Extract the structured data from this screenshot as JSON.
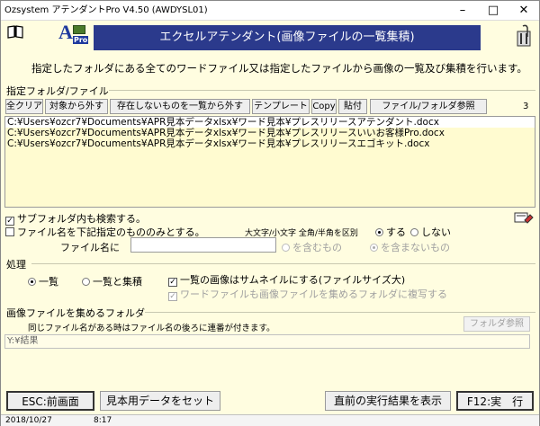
{
  "window": {
    "title": "Ozsystem アテンダントPro V4.50 (AWDYSL01)",
    "minimize": "–",
    "maximize": "□",
    "close": "✕"
  },
  "header": {
    "logo_letter": "A",
    "logo_sub": "Pro",
    "banner": "エクセルアテンダント(画像ファイルの一覧集積)",
    "description": "指定したフォルダにある全てのワードファイル又は指定したファイルから画像の一覧及び集積を行います。"
  },
  "folder_section": {
    "title": "指定フォルダ/ファイル",
    "count": "3",
    "buttons": {
      "clear_all": "全クリア",
      "remove_target": "対象から外す",
      "remove_missing": "存在しないものを一覧から外す",
      "template": "テンプレート",
      "copy": "Copy",
      "paste": "貼付",
      "browse": "ファイル/フォルダ参照"
    },
    "files": [
      "C:¥Users¥ozcr7¥Documents¥APR見本データxlsx¥ワード見本¥プレスリリースアテンダント.docx",
      "C:¥Users¥ozcr7¥Documents¥APR見本データxlsx¥ワード見本¥プレスリリースいいお客様Pro.docx",
      "C:¥Users¥ozcr7¥Documents¥APR見本データxlsx¥ワード見本¥プレスリリースエゴキット.docx"
    ]
  },
  "options": {
    "include_subfolders": "サブフォルダ内も検索する。",
    "filename_filter": "ファイル名を下記指定のもののみとする。",
    "case_label": "大文字/小文字 全角/半角を区別",
    "case_yes": "する",
    "case_no": "しない",
    "filename_in": "ファイル名に",
    "filename_value": "",
    "contains": "を含むもの",
    "not_contains": "を含まないもの"
  },
  "process": {
    "title": "処理",
    "list_only": "一覧",
    "list_and_collect": "一覧と集積",
    "thumbnail": "一覧の画像はサムネイルにする(ファイルサイズ大)",
    "copy_word": "ワードファイルも画像ファイルを集めるフォルダに複写する"
  },
  "collect": {
    "title": "画像ファイルを集めるフォルダ",
    "note": "同じファイル名がある時はファイル名の後ろに連番が付きます。",
    "browse": "フォルダ参照",
    "path": "Y:¥結果"
  },
  "footer": {
    "esc": "ESC:前画面",
    "sample": "見本用データをセット",
    "last_result": "直前の実行結果を表示",
    "f12": "F12:実　行"
  },
  "status": {
    "date": "2018/10/27",
    "time": "8:17"
  },
  "colors": {
    "banner_bg": "#2b3a8c",
    "window_bg": "#fffde0"
  }
}
